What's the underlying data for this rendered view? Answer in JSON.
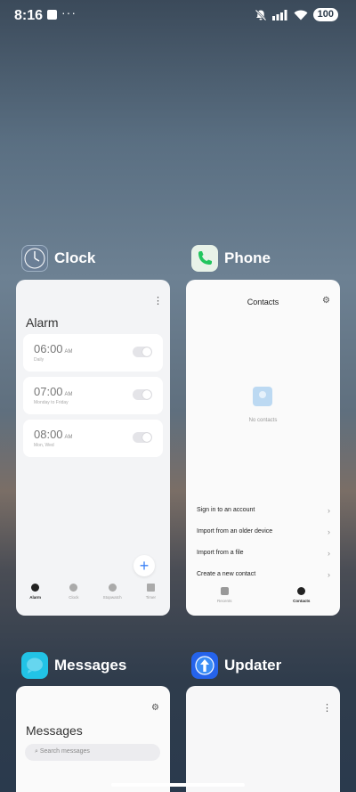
{
  "status_bar": {
    "time": "8:16",
    "more": "···",
    "battery": "100"
  },
  "apps": {
    "clock": {
      "title": "Clock",
      "screen": {
        "title": "Alarm",
        "alarms": [
          {
            "time": "06:00",
            "ampm": "AM",
            "sub": "Daily",
            "enabled": false
          },
          {
            "time": "07:00",
            "ampm": "AM",
            "sub": "Monday to Friday",
            "enabled": false
          },
          {
            "time": "08:00",
            "ampm": "AM",
            "sub": "Mon, Wed",
            "enabled": false
          }
        ],
        "tabs": [
          "Alarm",
          "Clock",
          "Stopwatch",
          "Timer"
        ]
      }
    },
    "phone": {
      "title": "Phone",
      "screen": {
        "title": "Contacts",
        "empty_text": "No contacts",
        "actions": [
          "Sign in to an account",
          "Import from an older device",
          "Import from a file",
          "Create a new contact"
        ],
        "tabs": [
          "Recents",
          "Contacts"
        ]
      }
    },
    "messages": {
      "title": "Messages",
      "screen": {
        "title": "Messages",
        "search_placeholder": "Search messages"
      }
    },
    "updater": {
      "title": "Updater"
    }
  },
  "colors": {
    "accent_blue": "#3b82f6",
    "phone_green": "#22c55e",
    "messages_cyan": "#22c3e6"
  }
}
